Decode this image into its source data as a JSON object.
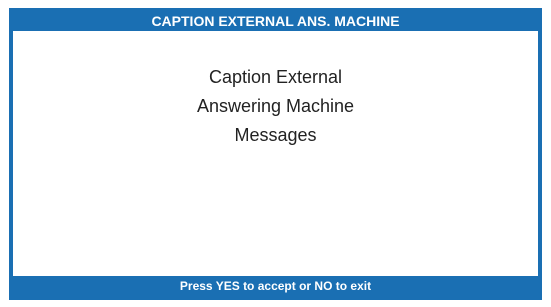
{
  "screen": {
    "title": "CAPTION EXTERNAL ANS. MACHINE",
    "message_lines": [
      "Caption External",
      "Answering Machine",
      "Messages"
    ],
    "footer": "Press YES to accept or NO to exit"
  },
  "colors": {
    "frame": "#1a6fb3",
    "bar_text": "#ffffff",
    "body_text": "#222222",
    "background": "#ffffff"
  }
}
